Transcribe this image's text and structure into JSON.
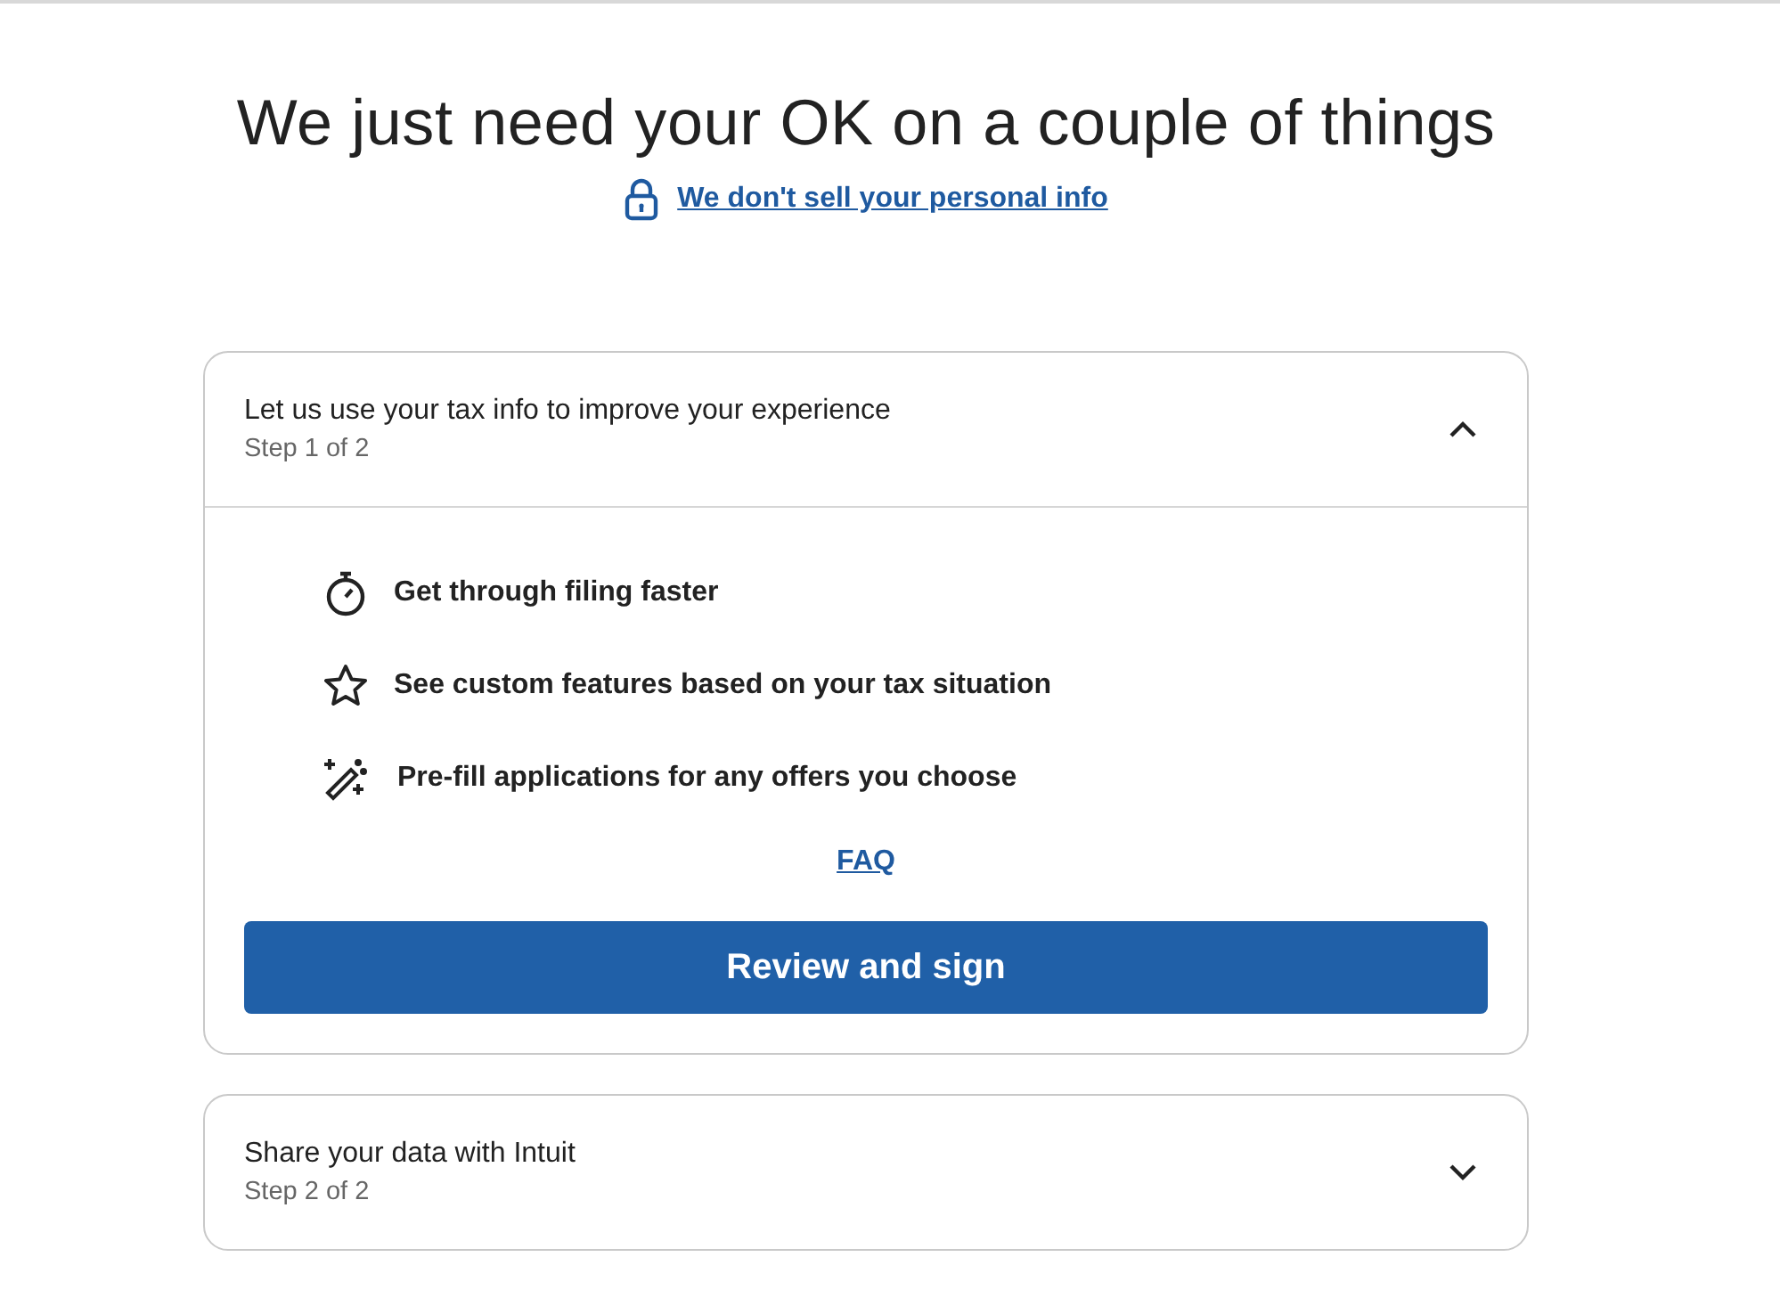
{
  "title": "We just need your OK on a couple of things",
  "privacy_link": "We don't sell your personal info",
  "steps": [
    {
      "title": "Let us use your tax info to improve your experience",
      "step": "Step 1 of 2",
      "expanded": true,
      "benefits": [
        {
          "kind": "timer",
          "text": "Get through filing faster"
        },
        {
          "kind": "star",
          "text": "See custom features based on your tax situation"
        },
        {
          "kind": "wand",
          "text": "Pre-fill applications for any offers you choose"
        }
      ],
      "faq_link": "FAQ",
      "button": "Review and sign"
    },
    {
      "title": "Share your data with Intuit",
      "step": "Step 2 of 2",
      "expanded": false
    }
  ]
}
